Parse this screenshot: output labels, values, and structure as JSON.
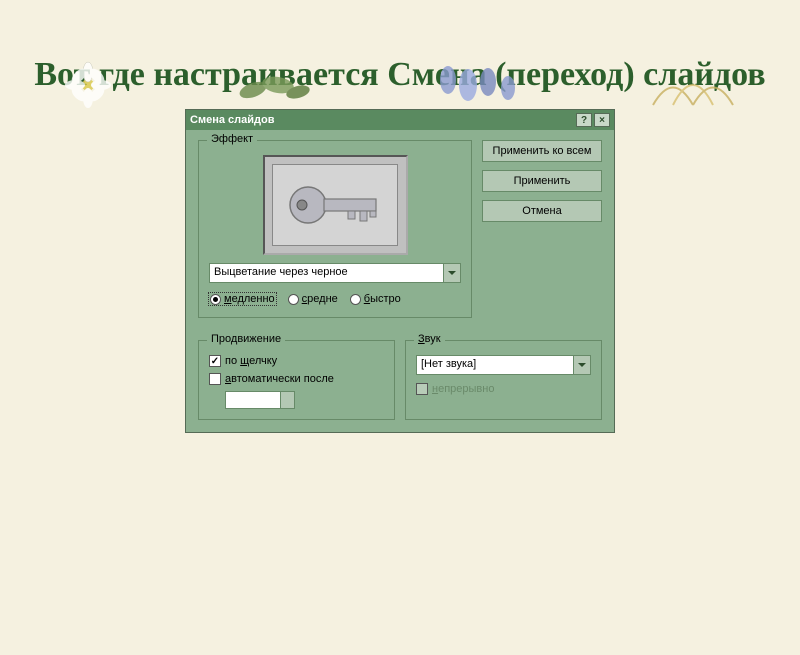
{
  "page_title": "Вот где настраивается Смена (переход) слайдов",
  "titlebar": {
    "title": "Смена слайдов",
    "help": "?",
    "close": "×"
  },
  "effect": {
    "group_label": "Эффект",
    "combo_value": "Выцветание через черное",
    "speed": {
      "slow": "медленно",
      "medium": "средне",
      "fast": "быстро",
      "selected": "slow"
    }
  },
  "actions": {
    "apply_all": "Применить ко всем",
    "apply": "Применить",
    "cancel": "Отмена"
  },
  "advance": {
    "group_label": "Продвижение",
    "on_click": "по щелчку",
    "auto_after": "автоматически после",
    "auto_value": "",
    "on_click_checked": true,
    "auto_checked": false
  },
  "sound": {
    "group_label": "Звук",
    "combo_value": "[Нет звука]",
    "loop": "непрерывно",
    "loop_enabled": false
  }
}
